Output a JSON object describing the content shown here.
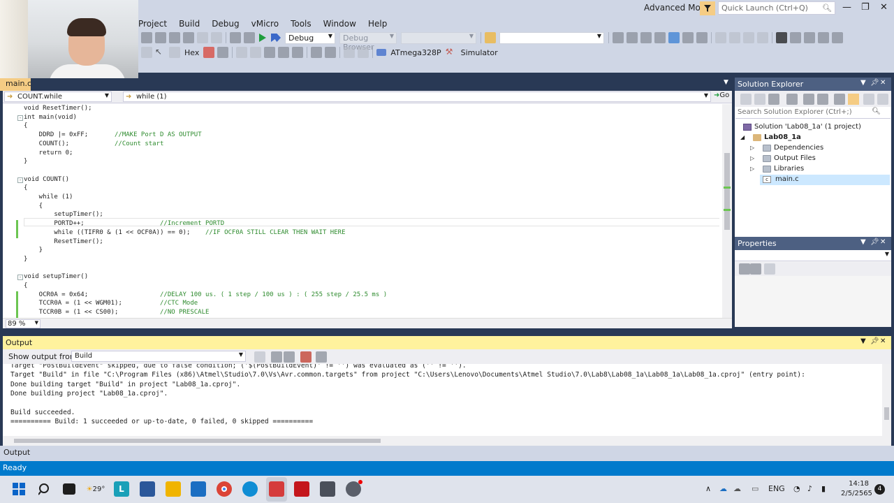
{
  "menu": [
    "Project",
    "Build",
    "Debug",
    "vMicro",
    "Tools",
    "Window",
    "Help"
  ],
  "title_area": {
    "mode": "Advanced Mode",
    "quick_launch_placeholder": "Quick Launch (Ctrl+Q)"
  },
  "toolbar": {
    "config": "Debug",
    "debug_browser": "Debug Browser",
    "hex_label": "Hex",
    "device": "ATmega328P",
    "tool": "Simulator"
  },
  "editor": {
    "tab": "main.c",
    "nav_left": "COUNT.while",
    "nav_right": "while (1)",
    "go_label": "Go",
    "zoom": "89 %",
    "lines": [
      {
        "t": "void ResetTimer();",
        "c": ""
      },
      {
        "t": "int main(void)",
        "c": ""
      },
      {
        "t": "{",
        "c": ""
      },
      {
        "t": "    DDRD |= 0xFF;       ",
        "c": "//MAKE Port D AS OUTPUT"
      },
      {
        "t": "    COUNT();            ",
        "c": "//Count start"
      },
      {
        "t": "    return 0;",
        "c": ""
      },
      {
        "t": "}",
        "c": ""
      },
      {
        "t": "",
        "c": ""
      },
      {
        "t": "void COUNT()",
        "c": ""
      },
      {
        "t": "{",
        "c": ""
      },
      {
        "t": "    while (1)",
        "c": ""
      },
      {
        "t": "    {",
        "c": ""
      },
      {
        "t": "        setupTimer();",
        "c": ""
      },
      {
        "t": "        PORTD++;                    ",
        "c": "//Increment PORTD"
      },
      {
        "t": "        while ((TIFR0 & (1 << OCF0A)) == 0);    ",
        "c": "//IF OCF0A STILL CLEAR THEN WAIT HERE"
      },
      {
        "t": "        ResetTimer();",
        "c": ""
      },
      {
        "t": "    }",
        "c": ""
      },
      {
        "t": "}",
        "c": ""
      },
      {
        "t": "",
        "c": ""
      },
      {
        "t": "void setupTimer()",
        "c": ""
      },
      {
        "t": "{",
        "c": ""
      },
      {
        "t": "    OCR0A = 0x64;                   ",
        "c": "//DELAY 100 us. ( 1 step / 100 us ) : ( 255 step / 25.5 ms )"
      },
      {
        "t": "    TCCR0A = (1 << WGM01);          ",
        "c": "//CTC Mode"
      },
      {
        "t": "    TCCR0B = (1 << CS00);           ",
        "c": "//NO PRESCALE"
      }
    ]
  },
  "solution_explorer": {
    "title": "Solution Explorer",
    "search_placeholder": "Search Solution Explorer (Ctrl+;)",
    "solution": "Solution 'Lab08_1a' (1 project)",
    "project": "Lab08_1a",
    "items": [
      "Dependencies",
      "Output Files",
      "Libraries",
      "main.c"
    ]
  },
  "properties": {
    "title": "Properties"
  },
  "output": {
    "title": "Output",
    "show_from_label": "Show output from:",
    "source": "Build",
    "lines": [
      "Target \"PostBuildEvent\" skipped, due to false condition; ('$(PostBuildEvent)' != '') was evaluated as ('' != '').",
      "Target \"Build\" in file \"C:\\Program Files (x86)\\Atmel\\Studio\\7.0\\Vs\\Avr.common.targets\" from project \"C:\\Users\\Lenovo\\Documents\\Atmel Studio\\7.0\\Lab8\\Lab08_1a\\Lab08_1a\\Lab08_1a.cproj\" (entry point):",
      "Done building target \"Build\" in project \"Lab08_1a.cproj\".",
      "Done building project \"Lab08_1a.cproj\".",
      "",
      "Build succeeded.",
      "========== Build: 1 succeeded or up-to-date, 0 failed, 0 skipped =========="
    ],
    "bottom_tab": "Output"
  },
  "status": "Ready",
  "taskbar": {
    "weather": "29°",
    "lang": "ENG",
    "time": "14:18",
    "date": "2/5/2565",
    "notifications": "4"
  },
  "colors": {
    "frame": "#293955",
    "accent_tab": "#f5cc84",
    "status": "#007acc",
    "output_header": "#fff29d",
    "comment": "#2e8b2e"
  }
}
